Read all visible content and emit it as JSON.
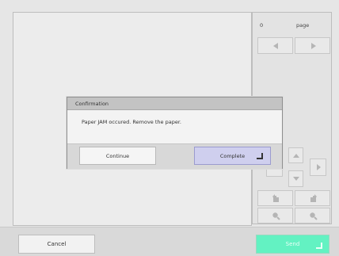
{
  "page_info": {
    "count_label": "0",
    "page_label": "page"
  },
  "dialog": {
    "title": "Confirmation",
    "message": "Paper JAM occured. Remove the paper.",
    "continue_label": "Continue",
    "complete_label": "Complete"
  },
  "footer": {
    "cancel_label": "Cancel",
    "send_label": "Send"
  },
  "colors": {
    "accent_send": "#63f2c2",
    "dialog_primary": "#cfcfee"
  },
  "icons": {
    "prev_page": "left-triangle-icon",
    "next_page": "right-triangle-icon",
    "scroll_up": "up-triangle-icon",
    "scroll_down": "down-triangle-icon",
    "scroll_right": "right-triangle-icon",
    "rotate_left": "rotate-left-icon",
    "rotate_right": "rotate-right-icon",
    "zoom_out": "zoom-out-icon",
    "zoom_in": "zoom-in-icon",
    "enter": "enter-icon"
  }
}
